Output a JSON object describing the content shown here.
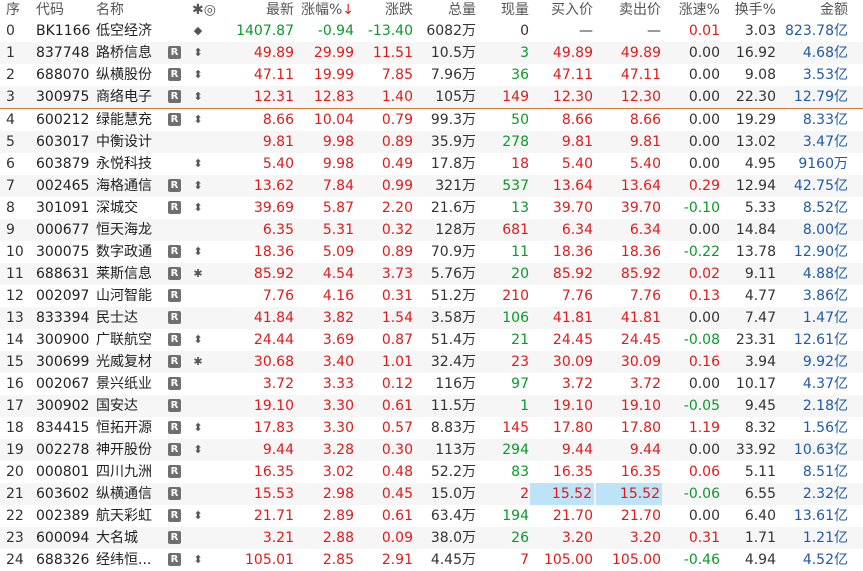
{
  "header": {
    "seq": "序",
    "code": "代码",
    "name": "名称",
    "mark": "✱◎",
    "price": "最新",
    "pct": "涨幅%",
    "pct_sort": "↓",
    "chg": "涨跌",
    "vol": "总量",
    "cur": "现量",
    "bid": "买入价",
    "ask": "卖出价",
    "spd": "涨速%",
    "tov": "换手%",
    "amt": "金额"
  },
  "rows": [
    {
      "seq": "0",
      "code": "BK1166",
      "name": "低空经济",
      "tag": "",
      "mark": "◆",
      "price": "1407.87",
      "pct": "-0.94",
      "chg": "-13.40",
      "vol": "6082万",
      "cur": "0",
      "bid": "—",
      "ask": "—",
      "spd": "0.01",
      "tov": "3.03",
      "amt": "823.78亿"
    },
    {
      "seq": "1",
      "code": "837748",
      "name": "路桥信息",
      "tag": "R",
      "mark": "⬍",
      "price": "49.89",
      "pct": "29.99",
      "chg": "11.51",
      "vol": "10.5万",
      "cur": "3",
      "bid": "49.89",
      "ask": "49.89",
      "spd": "0.00",
      "tov": "16.92",
      "amt": "4.68亿"
    },
    {
      "seq": "2",
      "code": "688070",
      "name": "纵横股份",
      "tag": "R",
      "mark": "⬍",
      "price": "47.11",
      "pct": "19.99",
      "chg": "7.85",
      "vol": "7.96万",
      "cur": "36",
      "bid": "47.11",
      "ask": "47.11",
      "spd": "0.00",
      "tov": "9.08",
      "amt": "3.53亿"
    },
    {
      "seq": "3",
      "code": "300975",
      "name": "商络电子",
      "tag": "R",
      "mark": "⬍",
      "price": "12.31",
      "pct": "12.83",
      "chg": "1.40",
      "vol": "105万",
      "cur": "149",
      "bid": "12.30",
      "ask": "12.30",
      "spd": "0.00",
      "tov": "22.30",
      "amt": "12.79亿"
    },
    {
      "seq": "4",
      "code": "600212",
      "name": "绿能慧充",
      "tag": "R",
      "mark": "⬍",
      "price": "8.66",
      "pct": "10.04",
      "chg": "0.79",
      "vol": "99.3万",
      "cur": "50",
      "bid": "8.66",
      "ask": "8.66",
      "spd": "0.00",
      "tov": "19.29",
      "amt": "8.33亿"
    },
    {
      "seq": "5",
      "code": "603017",
      "name": "中衡设计",
      "tag": "",
      "mark": "",
      "price": "9.81",
      "pct": "9.98",
      "chg": "0.89",
      "vol": "35.9万",
      "cur": "278",
      "bid": "9.81",
      "ask": "9.81",
      "spd": "0.00",
      "tov": "13.02",
      "amt": "3.47亿"
    },
    {
      "seq": "6",
      "code": "603879",
      "name": "永悦科技",
      "tag": "",
      "mark": "⬍",
      "price": "5.40",
      "pct": "9.98",
      "chg": "0.49",
      "vol": "17.8万",
      "cur": "18",
      "bid": "5.40",
      "ask": "5.40",
      "spd": "0.00",
      "tov": "4.95",
      "amt": "9160万"
    },
    {
      "seq": "7",
      "code": "002465",
      "name": "海格通信",
      "tag": "R",
      "mark": "⬍",
      "price": "13.62",
      "pct": "7.84",
      "chg": "0.99",
      "vol": "321万",
      "cur": "537",
      "bid": "13.64",
      "ask": "13.64",
      "spd": "0.29",
      "tov": "12.94",
      "amt": "42.75亿"
    },
    {
      "seq": "8",
      "code": "301091",
      "name": "深城交",
      "tag": "R",
      "mark": "⬍",
      "price": "39.69",
      "pct": "5.87",
      "chg": "2.20",
      "vol": "21.6万",
      "cur": "13",
      "bid": "39.70",
      "ask": "39.70",
      "spd": "-0.10",
      "tov": "5.33",
      "amt": "8.52亿"
    },
    {
      "seq": "9",
      "code": "000677",
      "name": "恒天海龙",
      "tag": "",
      "mark": "",
      "price": "6.35",
      "pct": "5.31",
      "chg": "0.32",
      "vol": "128万",
      "cur": "681",
      "bid": "6.34",
      "ask": "6.34",
      "spd": "0.00",
      "tov": "14.84",
      "amt": "8.00亿"
    },
    {
      "seq": "10",
      "code": "300075",
      "name": "数字政通",
      "tag": "R",
      "mark": "⬍",
      "price": "18.36",
      "pct": "5.09",
      "chg": "0.89",
      "vol": "70.9万",
      "cur": "11",
      "bid": "18.36",
      "ask": "18.36",
      "spd": "-0.22",
      "tov": "13.78",
      "amt": "12.90亿"
    },
    {
      "seq": "11",
      "code": "688631",
      "name": "莱斯信息",
      "tag": "R",
      "mark": "✱",
      "price": "85.92",
      "pct": "4.54",
      "chg": "3.73",
      "vol": "5.76万",
      "cur": "20",
      "bid": "85.92",
      "ask": "85.92",
      "spd": "0.02",
      "tov": "9.11",
      "amt": "4.88亿"
    },
    {
      "seq": "12",
      "code": "002097",
      "name": "山河智能",
      "tag": "R",
      "mark": "",
      "price": "7.76",
      "pct": "4.16",
      "chg": "0.31",
      "vol": "51.2万",
      "cur": "210",
      "bid": "7.76",
      "ask": "7.76",
      "spd": "0.13",
      "tov": "4.77",
      "amt": "3.86亿"
    },
    {
      "seq": "13",
      "code": "833394",
      "name": "民士达",
      "tag": "R",
      "mark": "",
      "price": "41.84",
      "pct": "3.82",
      "chg": "1.54",
      "vol": "3.58万",
      "cur": "106",
      "bid": "41.81",
      "ask": "41.81",
      "spd": "0.00",
      "tov": "7.47",
      "amt": "1.47亿"
    },
    {
      "seq": "14",
      "code": "300900",
      "name": "广联航空",
      "tag": "R",
      "mark": "⬍",
      "price": "24.44",
      "pct": "3.69",
      "chg": "0.87",
      "vol": "51.4万",
      "cur": "21",
      "bid": "24.45",
      "ask": "24.45",
      "spd": "-0.08",
      "tov": "23.31",
      "amt": "12.61亿"
    },
    {
      "seq": "15",
      "code": "300699",
      "name": "光威复材",
      "tag": "R",
      "mark": "✱",
      "price": "30.68",
      "pct": "3.40",
      "chg": "1.01",
      "vol": "32.4万",
      "cur": "23",
      "bid": "30.09",
      "ask": "30.09",
      "spd": "0.16",
      "tov": "3.94",
      "amt": "9.92亿"
    },
    {
      "seq": "16",
      "code": "002067",
      "name": "景兴纸业",
      "tag": "R",
      "mark": "",
      "price": "3.72",
      "pct": "3.33",
      "chg": "0.12",
      "vol": "116万",
      "cur": "97",
      "bid": "3.72",
      "ask": "3.72",
      "spd": "0.00",
      "tov": "10.17",
      "amt": "4.37亿"
    },
    {
      "seq": "17",
      "code": "300902",
      "name": "国安达",
      "tag": "R",
      "mark": "",
      "price": "19.10",
      "pct": "3.30",
      "chg": "0.61",
      "vol": "11.5万",
      "cur": "1",
      "bid": "19.10",
      "ask": "19.10",
      "spd": "-0.05",
      "tov": "9.45",
      "amt": "2.18亿"
    },
    {
      "seq": "18",
      "code": "834415",
      "name": "恒拓开源",
      "tag": "R",
      "mark": "⬍",
      "price": "17.83",
      "pct": "3.30",
      "chg": "0.57",
      "vol": "8.83万",
      "cur": "145",
      "bid": "17.80",
      "ask": "17.80",
      "spd": "1.19",
      "tov": "8.32",
      "amt": "1.56亿"
    },
    {
      "seq": "19",
      "code": "002278",
      "name": "神开股份",
      "tag": "R",
      "mark": "⬍",
      "price": "9.44",
      "pct": "3.28",
      "chg": "0.30",
      "vol": "113万",
      "cur": "294",
      "bid": "9.44",
      "ask": "9.44",
      "spd": "0.00",
      "tov": "33.92",
      "amt": "10.63亿"
    },
    {
      "seq": "20",
      "code": "000801",
      "name": "四川九洲",
      "tag": "R",
      "mark": "",
      "price": "16.35",
      "pct": "3.02",
      "chg": "0.48",
      "vol": "52.2万",
      "cur": "83",
      "bid": "16.35",
      "ask": "16.35",
      "spd": "0.06",
      "tov": "5.11",
      "amt": "8.51亿"
    },
    {
      "seq": "21",
      "code": "603602",
      "name": "纵横通信",
      "tag": "R",
      "mark": "",
      "price": "15.53",
      "pct": "2.98",
      "chg": "0.45",
      "vol": "15.0万",
      "cur": "2",
      "bid": "15.52",
      "ask": "15.52",
      "spd": "-0.06",
      "tov": "6.55",
      "amt": "2.32亿",
      "hl": true
    },
    {
      "seq": "22",
      "code": "002389",
      "name": "航天彩虹",
      "tag": "R",
      "mark": "⬍",
      "price": "21.71",
      "pct": "2.89",
      "chg": "0.61",
      "vol": "63.4万",
      "cur": "194",
      "bid": "21.70",
      "ask": "21.70",
      "spd": "0.00",
      "tov": "6.40",
      "amt": "13.61亿"
    },
    {
      "seq": "23",
      "code": "600094",
      "name": "大名城",
      "tag": "R",
      "mark": "",
      "price": "3.21",
      "pct": "2.88",
      "chg": "0.09",
      "vol": "38.0万",
      "cur": "26",
      "bid": "3.20",
      "ask": "3.20",
      "spd": "0.31",
      "tov": "1.71",
      "amt": "1.21亿"
    },
    {
      "seq": "24",
      "code": "688326",
      "name": "经纬恒...",
      "tag": "R",
      "mark": "⬍",
      "price": "105.01",
      "pct": "2.85",
      "chg": "2.91",
      "vol": "4.45万",
      "cur": "7",
      "bid": "105.00",
      "ask": "105.00",
      "spd": "-0.46",
      "tov": "4.94",
      "amt": "4.52亿"
    }
  ]
}
